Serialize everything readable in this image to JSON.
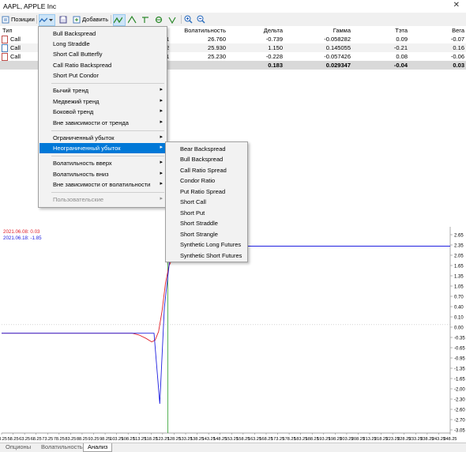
{
  "window": {
    "title": "AAPL, APPLE Inc",
    "close_glyph": "✕"
  },
  "toolbar": {
    "positions_label": "Позиции",
    "add_label": "Добавить",
    "icons": [
      "positions-icon",
      "strategy-icon",
      "save-icon",
      "add-icon",
      "curve-icon",
      "delta-icon",
      "gamma-icon",
      "theta-icon",
      "vega-icon",
      "zoom-in-icon",
      "zoom-out-icon"
    ]
  },
  "table": {
    "headers": [
      "Тип",
      "Волатильность",
      "Дельта",
      "Гамма",
      "Тэта",
      "Вега"
    ],
    "rows": [
      {
        "type": "Call",
        "qty_tail": "1",
        "volatility": "26.760",
        "delta": "-0.739",
        "gamma": "-0.058282",
        "theta": "0.09",
        "vega": "-0.07"
      },
      {
        "type": "Call",
        "qty_tail": "2",
        "volatility": "25.930",
        "delta": "1.150",
        "gamma": "0.145055",
        "theta": "-0.21",
        "vega": "0.16"
      },
      {
        "type": "Call",
        "qty_tail": "1",
        "volatility": "25.230",
        "delta": "-0.228",
        "gamma": "-0.057426",
        "theta": "0.08",
        "vega": "-0.06"
      }
    ],
    "totals": {
      "delta": "0.183",
      "gamma": "0.029347",
      "theta": "-0.04",
      "vega": "0.03"
    }
  },
  "menu": {
    "group1": [
      "Bull Backspread",
      "Long Straddle",
      "Short Call Butterfly",
      "Call Ratio Backspread",
      "Short Put Condor"
    ],
    "group2": [
      "Бычий тренд",
      "Медвежий тренд",
      "Боковой тренд",
      "Вне зависимости от тренда"
    ],
    "group3": [
      "Ограниченный убыток",
      "Неограниченный убыток"
    ],
    "group4": [
      "Волатильность вверх",
      "Волатильность вниз",
      "Вне зависимости от волатильности"
    ],
    "group5": [
      "Пользовательские"
    ],
    "arrow": "▸"
  },
  "submenu": {
    "items": [
      "Bear Backspread",
      "Bull Backspread",
      "Call Ratio Spread",
      "Condor Ratio",
      "Put Ratio Spread",
      "Short Call",
      "Short Put",
      "Short Straddle",
      "Short Strangle",
      "Synthetic Long Futures",
      "Synthetic Short Futures"
    ]
  },
  "chart_data": {
    "type": "line",
    "legend": [
      {
        "label": "2021.06.08: 0.03",
        "color": "#e0202a"
      },
      {
        "label": "2021.06.18: -1.85",
        "color": "#2020e0"
      }
    ],
    "y_ticks": [
      "2.65",
      "2.50",
      "2.35",
      "2.20",
      "2.05",
      "1.90",
      "1.75",
      "1.60",
      "1.45",
      "1.30",
      "1.15",
      "1.00",
      "0.85",
      "0.70",
      "0.55",
      "0.40",
      "0.25",
      "0.10",
      "-0.05",
      "-0.20",
      "-0.35",
      "-0.50",
      "-0.65",
      "-0.80",
      "-0.95",
      "-1.10",
      "-1.25",
      "-1.40",
      "-1.55",
      "-1.70",
      "-1.85",
      "-2.00"
    ],
    "y_tick_labels_shown": [
      "2.65",
      "2.35",
      "2.05",
      "1.75",
      "1.45",
      "1.15",
      "0.85",
      "0.55",
      "0.25",
      "0.00",
      "-0.35",
      "-0.65",
      "-0.95",
      "-1.25",
      "-1.55",
      "-1.85",
      "-2.15",
      "-2.45",
      "-2.70",
      "-3.05"
    ],
    "y_labels": [
      "2.65",
      "2.35",
      "2.05",
      "1.65",
      "1.35",
      "1.05",
      "0.70",
      "0.40",
      "0.10",
      "0.00",
      "-0.35",
      "-0.65",
      "-0.95",
      "-1.35",
      "-1.65",
      "-2.00",
      "-2.30",
      "-2.60",
      "-2.70",
      "-3.05"
    ],
    "x_labels": [
      "53.25",
      "58.25",
      "63.25",
      "68.25",
      "73.25",
      "78.25",
      "83.25",
      "88.25",
      "93.25",
      "98.25",
      "103.25",
      "108.25",
      "113.25",
      "118.25",
      "123.25",
      "128.25",
      "133.25",
      "138.25",
      "143.25",
      "148.25",
      "153.25",
      "158.25",
      "163.25",
      "168.25",
      "173.25",
      "178.25",
      "183.25",
      "188.25",
      "193.25",
      "198.25",
      "203.25",
      "208.25",
      "213.25",
      "218.25",
      "223.25",
      "228.25",
      "233.25",
      "238.25",
      "243.25",
      "248.25"
    ],
    "x_range": [
      53.25,
      248.25
    ],
    "y_range": [
      -3.15,
      2.75
    ],
    "zero_line": 0.0,
    "current_price": 125.5,
    "series": [
      {
        "name": "2021.06.08",
        "color": "#e0202a",
        "points": [
          [
            53.25,
            -0.25
          ],
          [
            110,
            -0.25
          ],
          [
            113,
            -0.3
          ],
          [
            116,
            -0.4
          ],
          [
            118.5,
            -0.5
          ],
          [
            120,
            -0.45
          ],
          [
            121.5,
            -0.2
          ],
          [
            123,
            0.4
          ],
          [
            124.5,
            1.2
          ],
          [
            126,
            1.7
          ],
          [
            128,
            2.0
          ],
          [
            131,
            2.2
          ],
          [
            135,
            2.27
          ],
          [
            140,
            2.28
          ],
          [
            248.25,
            2.28
          ]
        ]
      },
      {
        "name": "2021.06.18",
        "color": "#2020e0",
        "points": [
          [
            53.25,
            -0.25
          ],
          [
            119.5,
            -0.25
          ],
          [
            122,
            -2.3
          ],
          [
            124,
            0.5
          ],
          [
            127,
            2.28
          ],
          [
            248.25,
            2.28
          ]
        ]
      }
    ]
  },
  "bottom_tabs": [
    "Опционы",
    "Волатильность",
    "Анализ"
  ]
}
